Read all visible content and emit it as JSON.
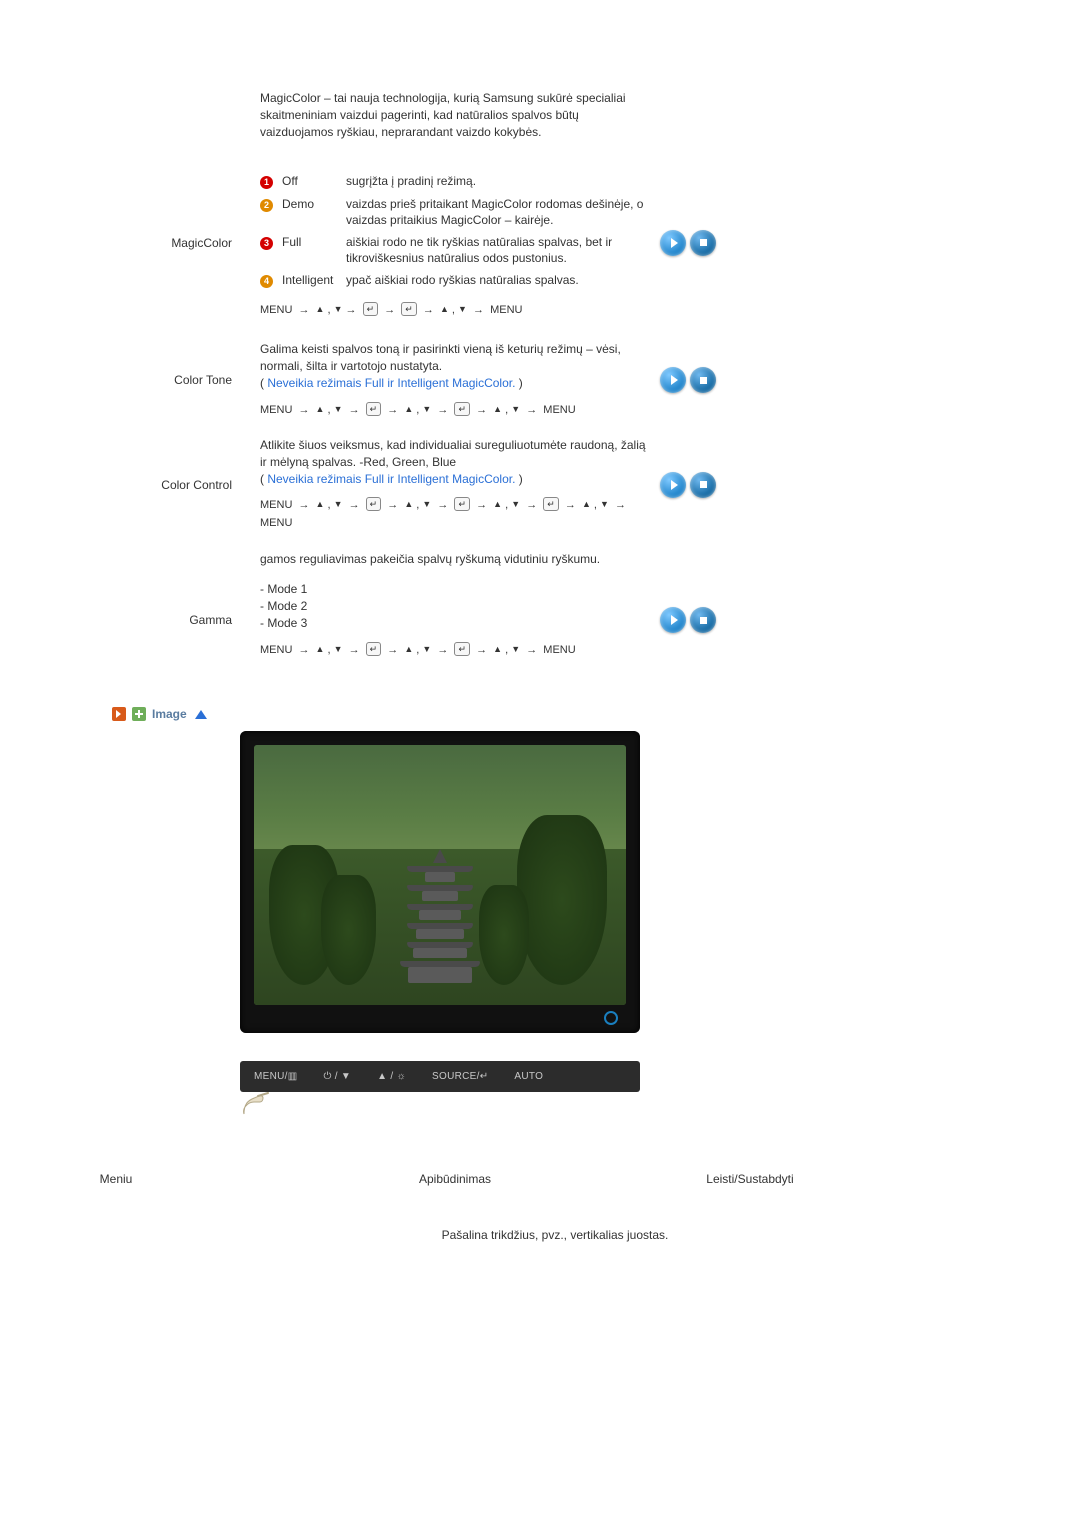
{
  "intro": "MagicColor – tai nauja technologija, kurią Samsung sukūrė specialiai skaitmeniniam vaizdui pagerinti, kad natūralios spalvos būtų vaizduojamos ryškiau, neprarandant vaizdo kokybės.",
  "rows": {
    "magiccolor": {
      "label": "MagicColor",
      "options": [
        {
          "num": "1",
          "name": "Off",
          "desc": "sugrįžta į pradinį režimą."
        },
        {
          "num": "2",
          "name": "Demo",
          "desc": "vaizdas prieš pritaikant MagicColor rodomas dešinėje, o vaizdas pritaikius MagicColor – kairėje."
        },
        {
          "num": "3",
          "name": "Full",
          "desc": "aiškiai rodo ne tik ryškias natūralias spalvas, bet ir tikroviškesnius natūralius odos pustonius."
        },
        {
          "num": "4",
          "name": "Intelligent",
          "desc": "ypač aiškiai rodo ryškias natūralias spalvas."
        }
      ],
      "nav": "MENU → ▲ , ▼→ ↵ → ↵ → ▲ , ▼ → MENU"
    },
    "colortone": {
      "label": "Color Tone",
      "desc": "Galima keisti spalvos toną ir pasirinkti vieną iš keturių režimų – vėsi, normali, šilta ir vartotojo nustatyta.",
      "note_prefix": "( ",
      "note_link": "Neveikia režimais Full ir Intelligent MagicColor.",
      "note_suffix": " )",
      "nav": "MENU → ▲ , ▼ → ↵ → ▲ , ▼ → ↵ → ▲ , ▼ → MENU"
    },
    "colorcontrol": {
      "label": "Color Control",
      "desc": "Atlikite šiuos veiksmus, kad individualiai sureguliuotumėte raudoną, žalią ir mėlyną spalvas. -Red, Green, Blue",
      "note_prefix": "( ",
      "note_link": "Neveikia režimais Full ir Intelligent MagicColor.",
      "note_suffix": " )",
      "nav": "MENU → ▲ , ▼ → ↵ → ▲ , ▼ → ↵ → ▲ , ▼ → ↵ → ▲ , ▼ → MENU"
    },
    "gamma": {
      "label": "Gamma",
      "desc": "gamos reguliavimas pakeičia spalvų ryškumą vidutiniu ryškumu.",
      "modes_label1": "- Mode 1",
      "modes_label2": "- Mode 2",
      "modes_label3": "- Mode 3",
      "nav": "MENU → ▲ , ▼ → ↵ → ▲ , ▼ → ↵ → ▲ , ▼ → MENU"
    }
  },
  "section": {
    "title": "Image"
  },
  "osd": {
    "b1": "MENU/▥",
    "b2": "⏻ / ▼",
    "b3": "▲ / ☼",
    "b4": "SOURCE/↵",
    "b5": "AUTO"
  },
  "footer": {
    "h1": "Meniu",
    "h2": "Apibūdinimas",
    "h3": "Leisti/Sustabdyti",
    "line": "Pašalina trikdžius, pvz., vertikalias juostas."
  }
}
